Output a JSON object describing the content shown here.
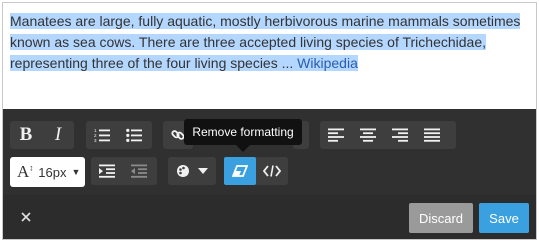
{
  "content": {
    "selected_text": "Manatees are large, fully aquatic, mostly herbivorous marine mammals sometimes known as sea cows. There are three accepted living species of Trichechidae, representing three of the four living species ...",
    "link_text": "Wikipedia"
  },
  "tooltip": {
    "text": "Remove formatting"
  },
  "toolbar": {
    "font_size": "16px",
    "icons": [
      "bold-icon",
      "italic-icon",
      "ordered-list-icon",
      "unordered-list-icon",
      "link-icon",
      "align-left-icon",
      "align-center-icon",
      "align-right-icon",
      "align-justify-icon",
      "font-size-icon",
      "indent-icon",
      "outdent-icon",
      "color-icon",
      "remove-formatting-icon",
      "code-icon"
    ]
  },
  "footer": {
    "discard_label": "Discard",
    "save_label": "Save"
  },
  "colors": {
    "accent": "#3aa0e0",
    "toolbar_bg": "#303030",
    "selection": "#b4d7ff",
    "discard_bg": "#9a9a9a"
  }
}
